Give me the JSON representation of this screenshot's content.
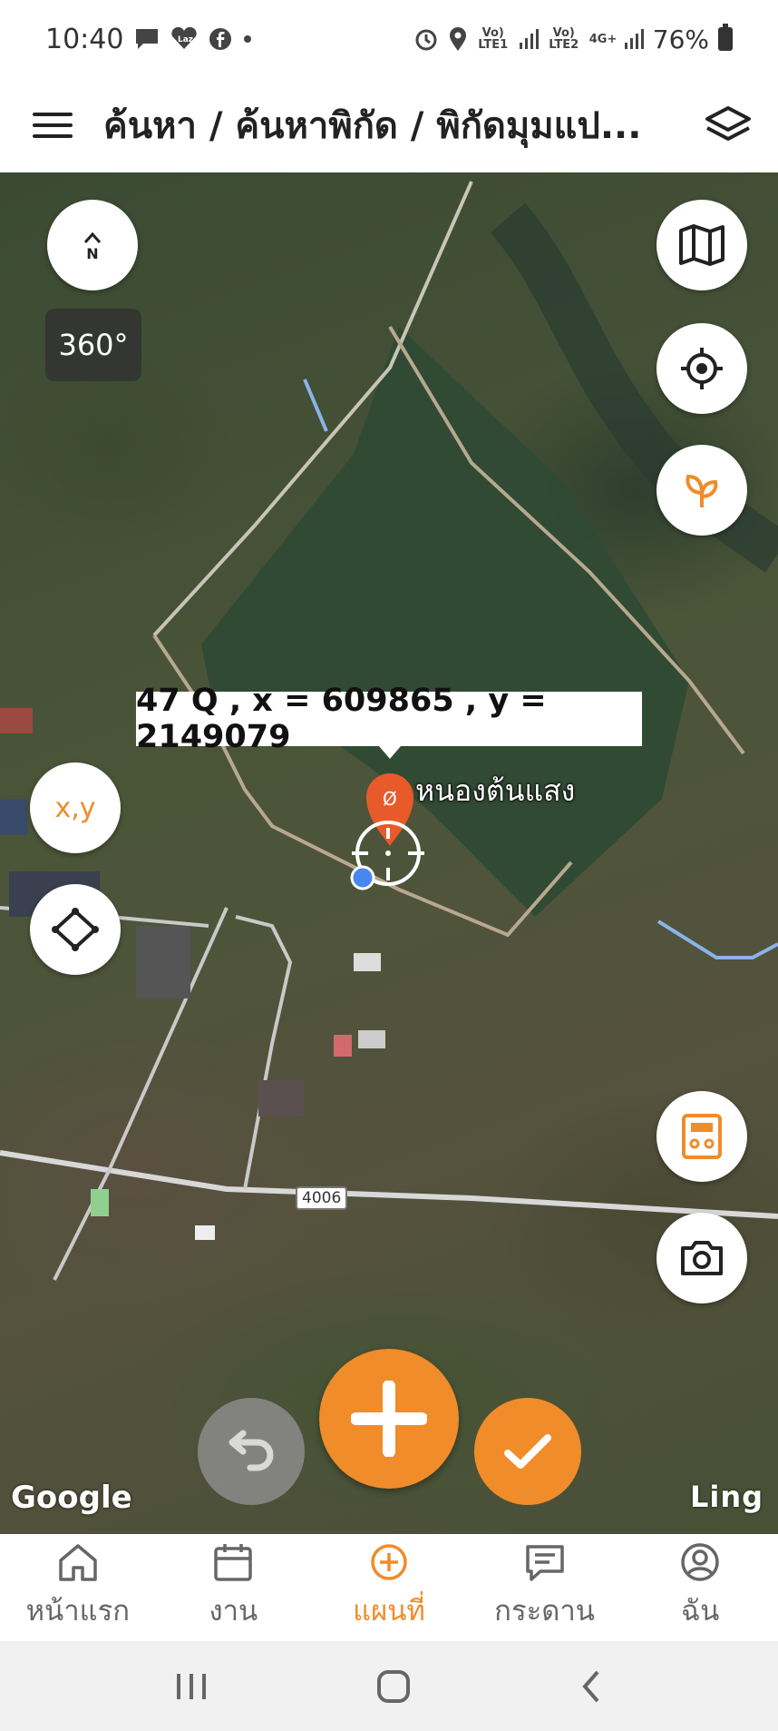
{
  "status_bar": {
    "time": "10:40",
    "notification_icons": [
      "message-icon",
      "lazada-icon",
      "facebook-icon",
      "dot-icon"
    ],
    "net1": "Vo) LTE1",
    "net2": "Vo) LTE2",
    "net_type": "4G+",
    "battery": "76%"
  },
  "app_bar": {
    "title": "ค้นหา / ค้นหาพิกัด / พิกัดมุมแป..."
  },
  "map": {
    "compass_label": "N",
    "rotation_label": "360°",
    "coord_label": "47 Q , x = 609865 , y = 2149079",
    "place_name": "หนองต้นแสง",
    "road_number": "4006",
    "google_label": "Google",
    "attribution": "Ling",
    "xy_button_label": "x,y",
    "accent_color": "#f08c2a"
  },
  "bottom_nav": {
    "items": [
      {
        "label": "หน้าแรก",
        "icon": "home-icon"
      },
      {
        "label": "งาน",
        "icon": "calendar-icon"
      },
      {
        "label": "แผนที่",
        "icon": "add-circle-icon",
        "active": true
      },
      {
        "label": "กระดาน",
        "icon": "board-icon"
      },
      {
        "label": "ฉัน",
        "icon": "profile-icon"
      }
    ]
  }
}
